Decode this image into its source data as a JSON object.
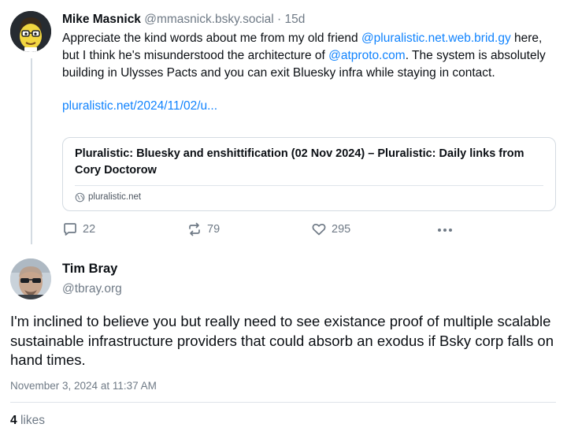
{
  "parent_post": {
    "author_name": "Mike Masnick",
    "author_handle": "@mmasnick.bsky.social",
    "separator": "·",
    "age": "15d",
    "text_before_mention_1": "Appreciate the kind words about me from my old friend ",
    "mention_1": "@pluralistic.net.web.brid.gy",
    "text_between_mentions": " here, but I think he's misunderstood the architecture of ",
    "mention_2": "@atproto.com",
    "text_after_mention_2": ". The system is absolutely building in Ulysses Pacts and you can exit Bluesky infra while staying in contact.",
    "link_text": "pluralistic.net/2024/11/02/u...",
    "embed": {
      "title": "Pluralistic: Bluesky and enshittification (02 Nov 2024) – Pluralistic: Daily links from Cory Doctorow",
      "domain": "pluralistic.net"
    },
    "actions": {
      "reply_count": "22",
      "repost_count": "79",
      "like_count": "295"
    }
  },
  "reply_post": {
    "author_name": "Tim Bray",
    "author_handle": "@tbray.org",
    "text": "I'm inclined to believe you but really need to see existance proof of multiple scalable sustainable infrastructure providers that could absorb an exodus if Bsky corp falls on hand times.",
    "timestamp": "November 3, 2024 at 11:37 AM",
    "like_count": "4",
    "likes_label": "likes"
  },
  "colors": {
    "link": "#1083fe",
    "muted": "#6f7a86",
    "border": "#d4dbe2",
    "text": "#0b0f14"
  },
  "icons": {
    "reply": "speech-bubble-icon",
    "repost": "repost-arrows-icon",
    "like": "heart-icon",
    "more": "ellipsis-icon",
    "domain": "globe-icon"
  }
}
